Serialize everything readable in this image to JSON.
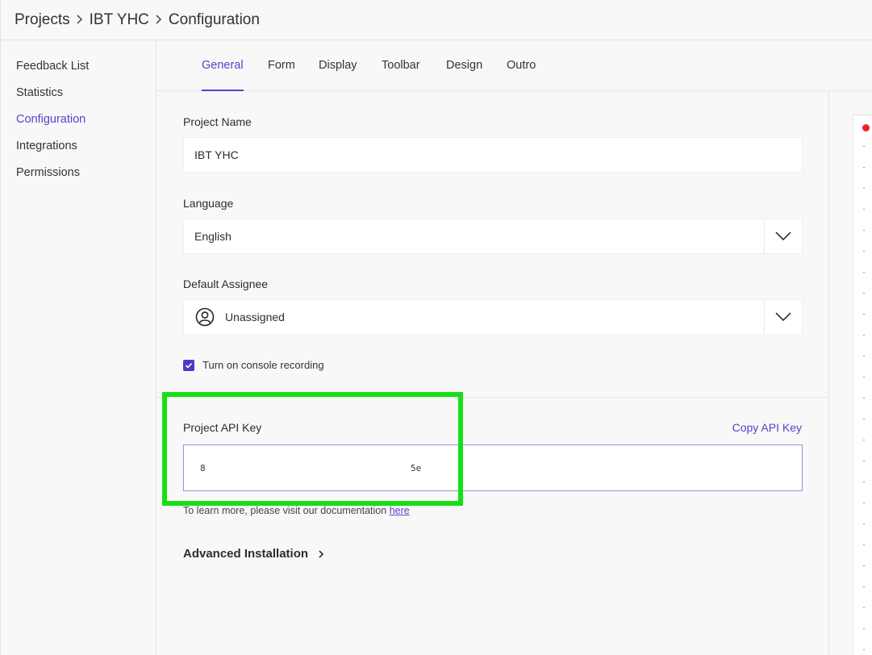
{
  "breadcrumb": {
    "items": [
      "Projects",
      "IBT YHC",
      "Configuration"
    ]
  },
  "sidebar": {
    "items": [
      {
        "label": "Feedback List"
      },
      {
        "label": "Statistics"
      },
      {
        "label": "Configuration",
        "active": true
      },
      {
        "label": "Integrations"
      },
      {
        "label": "Permissions"
      }
    ]
  },
  "tabs": [
    {
      "label": "General",
      "active": true
    },
    {
      "label": "Form"
    },
    {
      "label": "Display"
    },
    {
      "label": "Toolbar"
    },
    {
      "label": "Design"
    },
    {
      "label": "Outro"
    }
  ],
  "general": {
    "project_name_label": "Project Name",
    "project_name_value": "IBT YHC",
    "language_label": "Language",
    "language_value": "English",
    "assignee_label": "Default Assignee",
    "assignee_value": "Unassigned",
    "console_recording_label": "Turn on console recording",
    "console_recording_checked": true
  },
  "api": {
    "label": "Project API Key",
    "copy_label": "Copy API Key",
    "key_start": "8",
    "key_end": "5e",
    "help_text": "To learn more, please visit our documentation ",
    "help_link": "here"
  },
  "advanced": {
    "label": "Advanced Installation"
  },
  "colors": {
    "accent": "#5b41c8",
    "highlight": "#15e015",
    "record_dot": "#e8231d"
  },
  "icons": {
    "breadcrumb_separator": "chevron-right-icon",
    "select": "chevron-down-icon",
    "assignee": "user-circle-icon",
    "checkbox": "check-icon",
    "advanced": "chevron-right-icon"
  }
}
